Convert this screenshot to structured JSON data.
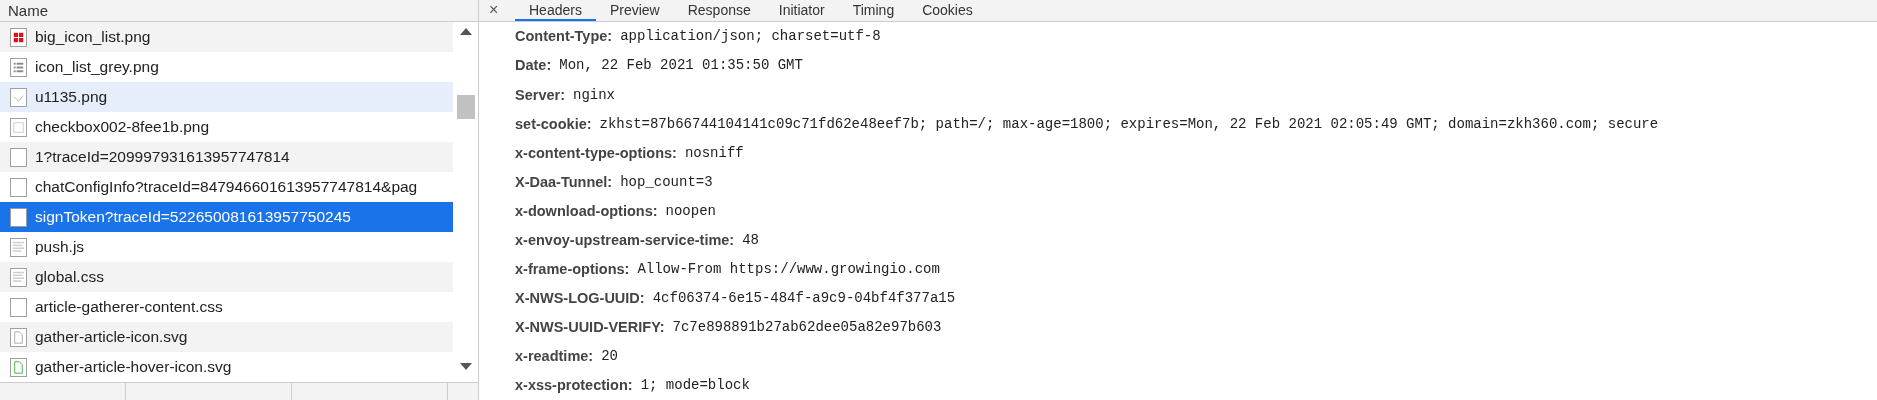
{
  "requests": {
    "column_header": "Name",
    "rows": [
      {
        "name": "big_icon_list.png",
        "kind": "grid",
        "selected": false,
        "hovered": false
      },
      {
        "name": "icon_list_grey.png",
        "kind": "list",
        "selected": false,
        "hovered": false
      },
      {
        "name": "u1135.png",
        "kind": "check",
        "selected": false,
        "hovered": true
      },
      {
        "name": "checkbox002-8fee1b.png",
        "kind": "checkbox",
        "selected": false,
        "hovered": false
      },
      {
        "name": "1?traceId=209997931613957747814",
        "kind": "blank",
        "selected": false,
        "hovered": false
      },
      {
        "name": "chatConfigInfo?traceId=847946601613957747814&pag",
        "kind": "blank",
        "selected": false,
        "hovered": false
      },
      {
        "name": "signToken?traceId=522650081613957750245",
        "kind": "blank",
        "selected": true,
        "hovered": false
      },
      {
        "name": "push.js",
        "kind": "script",
        "selected": false,
        "hovered": false
      },
      {
        "name": "global.css",
        "kind": "script",
        "selected": false,
        "hovered": false
      },
      {
        "name": "article-gatherer-content.css",
        "kind": "blank",
        "selected": false,
        "hovered": false
      },
      {
        "name": "gather-article-icon.svg",
        "kind": "svg",
        "selected": false,
        "hovered": false
      },
      {
        "name": "gather-article-hover-icon.svg",
        "kind": "svg-green",
        "selected": false,
        "hovered": false
      }
    ]
  },
  "detail": {
    "close": "×",
    "tabs": [
      {
        "label": "Headers",
        "selected": true
      },
      {
        "label": "Preview",
        "selected": false
      },
      {
        "label": "Response",
        "selected": false
      },
      {
        "label": "Initiator",
        "selected": false
      },
      {
        "label": "Timing",
        "selected": false
      },
      {
        "label": "Cookies",
        "selected": false
      }
    ],
    "headers": [
      {
        "name": "Content-Type:",
        "value": "application/json; charset=utf-8"
      },
      {
        "name": "Date:",
        "value": "Mon, 22 Feb 2021 01:35:50 GMT"
      },
      {
        "name": "Server:",
        "value": "nginx"
      },
      {
        "name": "set-cookie:",
        "value": "zkhst=87b66744104141c09c71fd62e48eef7b; path=/; max-age=1800; expires=Mon, 22 Feb 2021 02:05:49 GMT; domain=zkh360.com; secure"
      },
      {
        "name": "x-content-type-options:",
        "value": "nosniff"
      },
      {
        "name": "X-Daa-Tunnel:",
        "value": "hop_count=3"
      },
      {
        "name": "x-download-options:",
        "value": "noopen"
      },
      {
        "name": "x-envoy-upstream-service-time:",
        "value": "48"
      },
      {
        "name": "x-frame-options:",
        "value": "Allow-From https://www.growingio.com"
      },
      {
        "name": "X-NWS-LOG-UUID:",
        "value": "4cf06374-6e15-484f-a9c9-04bf4f377a15"
      },
      {
        "name": "X-NWS-UUID-VERIFY:",
        "value": "7c7e898891b27ab62dee05a82e97b603"
      },
      {
        "name": "x-readtime:",
        "value": "20"
      },
      {
        "name": "x-xss-protection:",
        "value": "1; mode=block"
      }
    ]
  }
}
